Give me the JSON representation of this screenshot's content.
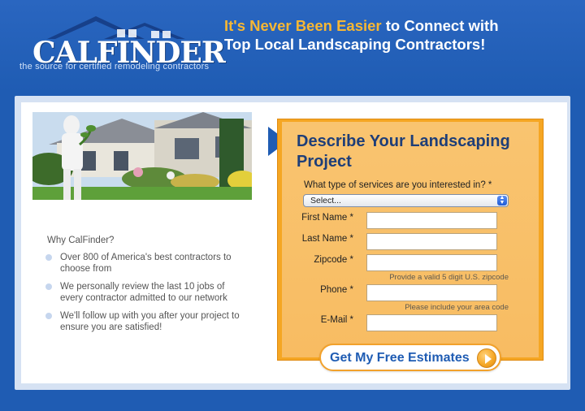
{
  "brand": {
    "logo_text": "CALFINDER",
    "tagline": "the source for certified remodeling contractors"
  },
  "headline": {
    "accent": "It's Never Been Easier",
    "rest_line1": " to Connect with",
    "line2": "Top Local Landscaping Contractors!"
  },
  "why": {
    "title": "Why CalFinder?",
    "bullets": [
      "Over 800 of America's best contractors to choose from",
      "We personally review the last 10 jobs of every contractor admitted to our network",
      "We'll follow up with you after your project to ensure you are satisfied!"
    ]
  },
  "form": {
    "title": "Describe Your Landscaping Project",
    "service_question": "What type of services are you interested in? *",
    "service_select_value": "Select...",
    "first_name_label": "First Name *",
    "last_name_label": "Last Name *",
    "zipcode_label": "Zipcode *",
    "zipcode_hint": "Provide a valid 5 digit U.S. zipcode",
    "phone_label": "Phone *",
    "phone_hint": "Please include your area code",
    "email_label": "E-Mail *",
    "submit_label": "Get My Free Estimates"
  },
  "colors": {
    "header_bg": "#1f5cb3",
    "accent_orange": "#f5a623",
    "headline_accent": "#f7b733",
    "title_blue": "#1e3e78"
  },
  "icons": {
    "select_arrows": "updown-arrows-icon",
    "submit_arrow": "play-arrow-icon",
    "section_pointer": "triangle-pointer-icon"
  }
}
